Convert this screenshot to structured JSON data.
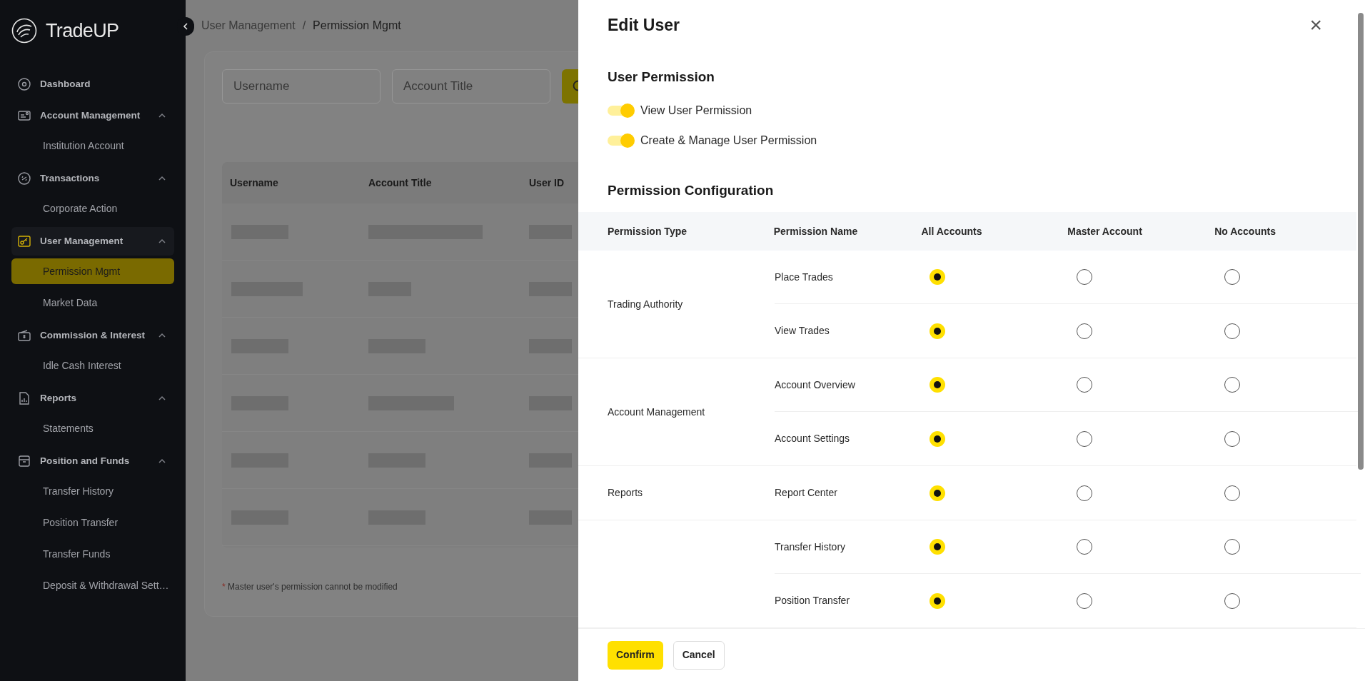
{
  "sidebar": {
    "logo": "TradeUP",
    "items": [
      {
        "label": "Dashboard",
        "selected": false
      },
      {
        "label": "Account Management",
        "selected": false,
        "expanded": true,
        "children": [
          {
            "label": "Institution Account",
            "selected": false
          }
        ]
      },
      {
        "label": "Transactions",
        "selected": false,
        "expanded": true,
        "children": [
          {
            "label": "Corporate Action",
            "selected": false
          }
        ]
      },
      {
        "label": "User Management",
        "selected": true,
        "expanded": true,
        "children": [
          {
            "label": "Permission Mgmt",
            "selected": true
          },
          {
            "label": "Market Data",
            "selected": false
          }
        ]
      },
      {
        "label": "Commission & Interest",
        "selected": false,
        "expanded": true,
        "children": [
          {
            "label": "Idle Cash Interest",
            "selected": false
          }
        ]
      },
      {
        "label": "Reports",
        "selected": false,
        "expanded": true,
        "children": [
          {
            "label": "Statements",
            "selected": false
          }
        ]
      },
      {
        "label": "Position and Funds",
        "selected": false,
        "expanded": true,
        "children": [
          {
            "label": "Transfer History",
            "selected": false
          },
          {
            "label": "Position Transfer",
            "selected": false
          },
          {
            "label": "Transfer Funds",
            "selected": false
          },
          {
            "label": "Deposit & Withdrawal Sett…",
            "selected": false
          }
        ]
      }
    ]
  },
  "breadcrumb": [
    "User Management",
    "/",
    "Permission Mgmt"
  ],
  "filters": [
    {
      "placeholder": "Username"
    },
    {
      "placeholder": "Account Title"
    }
  ],
  "table": {
    "columns": [
      "Username",
      "Account Title",
      "User ID"
    ]
  },
  "note": {
    "mark": "*",
    "text": "Master user's permission cannot be modified"
  },
  "drawer": {
    "title": "Edit User",
    "close": "×",
    "user_permission": {
      "title": "User Permission",
      "toggles": [
        {
          "label": "View User Permission",
          "on": true
        },
        {
          "label": "Create & Manage User Permission",
          "on": true
        }
      ]
    },
    "configuration": {
      "title": "Permission Configuration",
      "columns": [
        "Permission Type",
        "Permission Name",
        "All Accounts",
        "Master Account",
        "No Accounts"
      ],
      "groups": [
        {
          "type": "Trading Authority",
          "rows": [
            {
              "name": "Place Trades",
              "choices": [
                {
                  "selected": true
                },
                {
                  "selected": false
                },
                {
                  "selected": false
                }
              ]
            },
            {
              "name": "View Trades",
              "choices": [
                {
                  "selected": true
                },
                {
                  "selected": false
                },
                {
                  "selected": false
                }
              ]
            }
          ]
        },
        {
          "type": "Account Management",
          "rows": [
            {
              "name": "Account Overview",
              "choices": [
                {
                  "selected": true
                },
                {
                  "selected": false
                },
                {
                  "selected": false
                }
              ]
            },
            {
              "name": "Account Settings",
              "choices": [
                {
                  "selected": true
                },
                {
                  "selected": false
                },
                {
                  "selected": false
                }
              ]
            }
          ]
        },
        {
          "type": "Reports",
          "rows": [
            {
              "name": "Report Center",
              "choices": [
                {
                  "selected": true
                },
                {
                  "selected": false
                },
                {
                  "selected": false
                }
              ]
            }
          ]
        },
        {
          "rows": [
            {
              "name": "Transfer History",
              "choices": [
                {
                  "selected": true
                },
                {
                  "selected": false
                },
                {
                  "selected": false
                }
              ]
            },
            {
              "name": "Position Transfer",
              "choices": [
                {
                  "selected": true
                },
                {
                  "selected": false
                },
                {
                  "selected": false
                }
              ]
            }
          ]
        }
      ]
    },
    "buttons": [
      {
        "label": "Confirm",
        "kind": "primary"
      },
      {
        "label": "Cancel",
        "kind": "secondary"
      }
    ]
  }
}
